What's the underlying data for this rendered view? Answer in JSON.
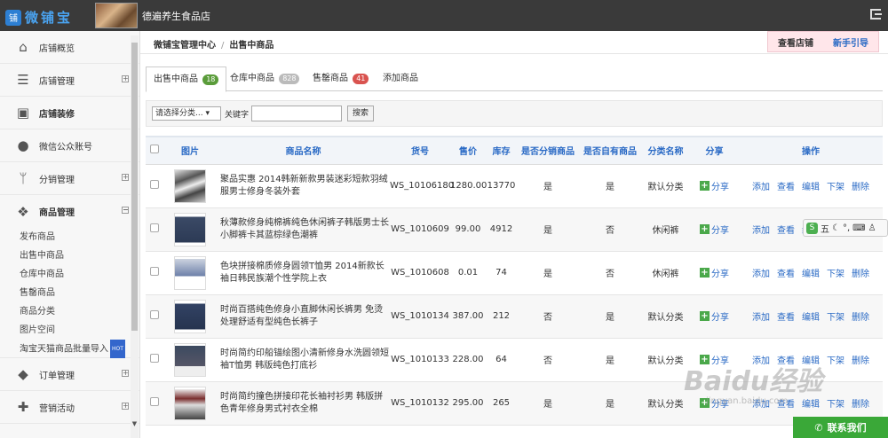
{
  "top": {
    "logo_mark": "铺",
    "logo_text": "微铺宝",
    "shop_name": "德遍养生食品店"
  },
  "breadcrumb": {
    "home": "微铺宝管理中心",
    "current": "出售中商品",
    "view_shop": "查看店铺",
    "guide": "新手引导"
  },
  "sidebar": {
    "items": [
      {
        "label": "店铺概览",
        "icon": "home-icon"
      },
      {
        "label": "店铺管理",
        "icon": "list-icon"
      },
      {
        "label": "店铺装修",
        "icon": "image-icon"
      },
      {
        "label": "微信公众账号",
        "icon": "wechat-icon"
      },
      {
        "label": "分销管理",
        "icon": "branch-icon"
      },
      {
        "label": "商品管理",
        "icon": "cubes-icon"
      }
    ],
    "sub_items": [
      "发布商品",
      "出售中商品",
      "仓库中商品",
      "售罄商品",
      "商品分类",
      "图片空间",
      "淘宝天猫商品批量导入"
    ],
    "hot": "HOT",
    "bottom_items": [
      {
        "label": "订单管理",
        "icon": "tag-icon"
      },
      {
        "label": "营销活动",
        "icon": "gift-icon"
      }
    ]
  },
  "tabs": [
    {
      "label": "出售中商品",
      "count": "18",
      "color": "#5a9c3a"
    },
    {
      "label": "仓库中商品",
      "count": "828",
      "color": "#bbbbbb"
    },
    {
      "label": "售罄商品",
      "count": "41",
      "color": "#d9534f"
    },
    {
      "label": "添加商品",
      "count": "",
      "color": ""
    }
  ],
  "search": {
    "category_select": "请选择分类... ▾",
    "keyword_label": "关键字",
    "button": "搜索"
  },
  "table": {
    "headers": [
      "图片",
      "商品名称",
      "货号",
      "售价",
      "库存",
      "是否分销商品",
      "是否自有商品",
      "分类名称",
      "分享",
      "操作"
    ],
    "share_label": "分享",
    "ops": [
      "添加",
      "查看",
      "编辑",
      "下架",
      "删除"
    ],
    "rows": [
      {
        "name": "聚品实惠 2014韩新新款男装迷彩短款羽绒服男士修身冬装外套",
        "sku": "WS_10106180",
        "price": "1280.00",
        "stock": "13770",
        "dist": "是",
        "own": "是",
        "category": "默认分类"
      },
      {
        "name": "秋薄款修身纯棉裤纯色休闲裤子韩版男士长小脚裤卡其蓝棕绿色潮裤",
        "sku": "WS_1010609",
        "price": "99.00",
        "stock": "4912",
        "dist": "是",
        "own": "否",
        "category": "休闲裤"
      },
      {
        "name": "色块拼接棉质修身圆领T恤男 2014新款长袖日韩民族潮个性学院上衣",
        "sku": "WS_1010608",
        "price": "0.01",
        "stock": "74",
        "dist": "是",
        "own": "否",
        "category": "休闲裤"
      },
      {
        "name": "时尚百搭纯色修身小直脚休闲长裤男 免烫处理舒适有型纯色长裤子",
        "sku": "WS_1010134",
        "price": "387.00",
        "stock": "212",
        "dist": "否",
        "own": "是",
        "category": "默认分类"
      },
      {
        "name": "时尚简约印船锚绘图小清新修身水洗圆领短袖T恤男 韩版纯色打底衫",
        "sku": "WS_1010133",
        "price": "228.00",
        "stock": "64",
        "dist": "否",
        "own": "是",
        "category": "默认分类"
      },
      {
        "name": "时尚简约撞色拼接印花长袖衬衫男 韩版拼色青年修身男式衬衣全棉",
        "sku": "WS_1010132",
        "price": "295.00",
        "stock": "265",
        "dist": "是",
        "own": "是",
        "category": "默认分类"
      }
    ]
  },
  "ime": {
    "label": "五"
  },
  "contact": "联系我们",
  "watermark": {
    "text": "Baidu经验",
    "url": "jingyan.baidu.com"
  }
}
